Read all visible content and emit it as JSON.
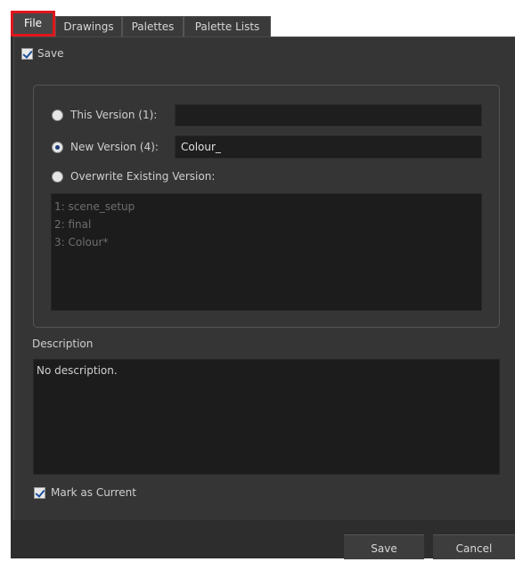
{
  "tabs": [
    {
      "label": "File",
      "active": true
    },
    {
      "label": "Drawings"
    },
    {
      "label": "Palettes"
    },
    {
      "label": "Palette Lists"
    }
  ],
  "save_checkbox": {
    "label": "Save",
    "checked": true
  },
  "version_options": {
    "this_version": {
      "label": "This Version (1):",
      "value": "",
      "selected": false
    },
    "new_version": {
      "label": "New Version (4):",
      "value": "Colour_",
      "selected": true
    },
    "overwrite": {
      "label": "Overwrite Existing Version:",
      "selected": false
    },
    "versions": [
      "1: scene_setup",
      "2: final",
      "3: Colour*"
    ]
  },
  "description": {
    "heading": "Description",
    "text": "No description."
  },
  "mark_as_current": {
    "label": "Mark as Current",
    "checked": true
  },
  "buttons": {
    "save": "Save",
    "cancel": "Cancel"
  },
  "colors": {
    "highlight": "#e1161d",
    "background": "#2d2d2d"
  }
}
